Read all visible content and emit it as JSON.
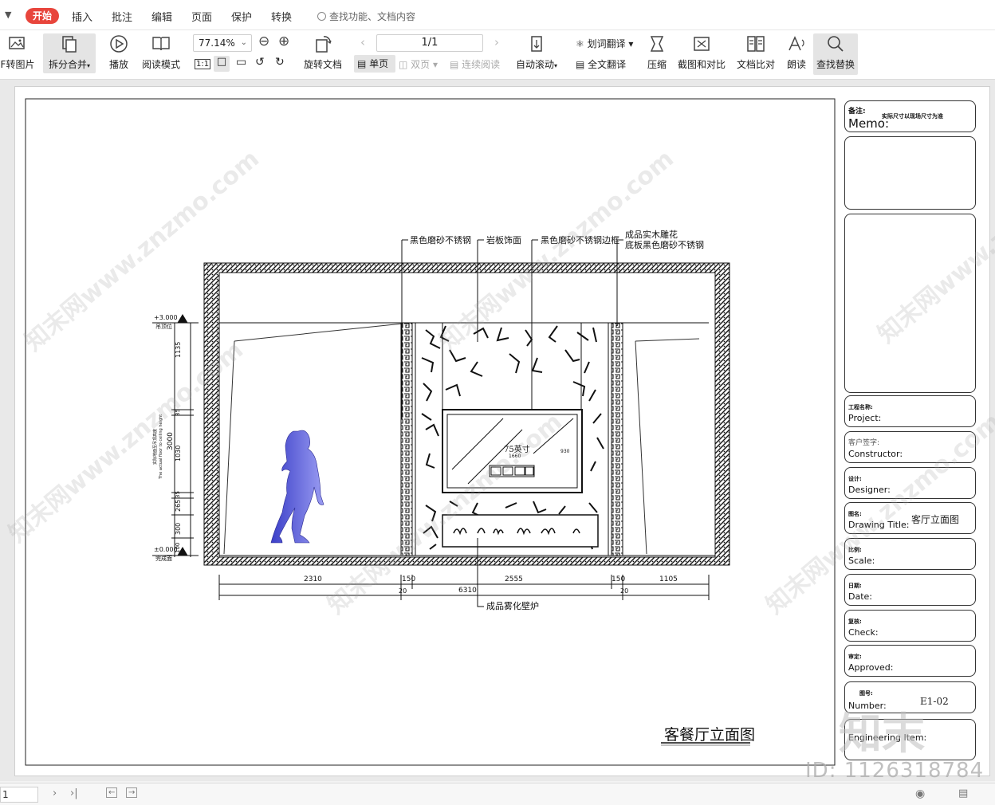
{
  "tabs": {
    "active": "开始",
    "items": [
      "插入",
      "批注",
      "编辑",
      "页面",
      "保护",
      "转换"
    ],
    "search_placeholder": "查找功能、文档内容"
  },
  "toolbar": {
    "pdf_to_image": "F转图片",
    "split_merge": "拆分合并",
    "play": "播放",
    "read_mode": "阅读模式",
    "zoom": "77.14%",
    "rotate": "旋转文档",
    "page_indicator": "1/1",
    "single_page": "单页",
    "double_page": "双页",
    "continuous": "连续阅读",
    "auto_scroll": "自动滚动",
    "word_translate": "划词翻译",
    "full_translate": "全文翻译",
    "compress": "压缩",
    "screenshot_compare": "截图和对比",
    "doc_compare": "文档比对",
    "read_aloud": "朗读",
    "find_replace": "查找替换",
    "actual_size": "1:1"
  },
  "drawing": {
    "labels_top": [
      "黑色磨砂不锈钢",
      "岩板饰面",
      "黑色磨砂不锈钢边框",
      "成品实木雕花",
      "底板黑色磨砂不锈钢"
    ],
    "label_bottom": "成品雾化壁炉",
    "tv_label": "75英寸",
    "tv_width": "1660",
    "tv_height": "930",
    "level_top": "+3.000",
    "level_top_sub": "吊顶位",
    "level_bottom": "±0.000",
    "level_bottom_sub": "完成面",
    "vertical_dims": [
      "1135",
      "35",
      "1030",
      "35",
      "265",
      "300",
      "100"
    ],
    "total_height": "3000",
    "height_note_cn": "实际地面至吊顶高度",
    "height_note_en": "The actual floor to ceiling height",
    "horizontal_dims": [
      "2310",
      "150",
      "2555",
      "150",
      "1105"
    ],
    "horizontal_small": [
      "20",
      "20"
    ],
    "total_width": "6310",
    "title": "客餐厅立面图"
  },
  "title_block": {
    "memo_cn": "备注:",
    "memo_note": "实际尺寸以现场尺寸为准",
    "memo_en": "Memo:",
    "project_cn": "工程名称:",
    "project_en": "Project:",
    "constructor_cn": "客户签字:",
    "constructor_en": "Constructor:",
    "designer_cn": "设计:",
    "designer_en": "Designer:",
    "drawing_title_cn": "图名:",
    "drawing_title_en": "Drawing  Title:",
    "drawing_title_value": "客厅立面图",
    "scale_cn": "比例:",
    "scale_en": "Scale:",
    "date_cn": "日期:",
    "date_en": "Date:",
    "check_cn": "复核:",
    "check_en": "Check:",
    "approved_cn": "审定:",
    "approved_en": "Approved:",
    "number_cn": "图号:",
    "number_en": "Number:",
    "number_value": "E1-02",
    "eng_item_en": "Engineering  Item:"
  },
  "watermark": {
    "text": "知末网www.znzmo.com",
    "id": "ID: 1126318784",
    "logo": "知末"
  },
  "statusbar": {
    "page_input": "1"
  }
}
